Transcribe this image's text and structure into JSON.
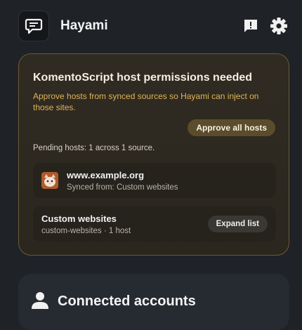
{
  "header": {
    "app_name": "Hayami",
    "logo_icon": "chat-bubble-icon",
    "report_icon": "feedback-icon",
    "settings_icon": "gear-icon"
  },
  "permissions": {
    "title": "KomentoScript host permissions needed",
    "description": "Approve hosts from synced sources so Hayami can inject on those sites.",
    "approve_label": "Approve all hosts",
    "pending_text": "Pending hosts: 1 across 1 source.",
    "host": {
      "domain": "www.example.org",
      "synced_from": "Synced from: Custom websites",
      "favicon": "cat-favicon-icon"
    },
    "source": {
      "name": "Custom websites",
      "detail": "custom-websites · 1 host",
      "expand_label": "Expand list"
    }
  },
  "accounts": {
    "title": "Connected accounts",
    "icon": "user-icon"
  },
  "colors": {
    "background": "#1f2227",
    "card_border": "#6b5a34",
    "accent_text": "#e0b355",
    "button": "#5b4c2c"
  }
}
